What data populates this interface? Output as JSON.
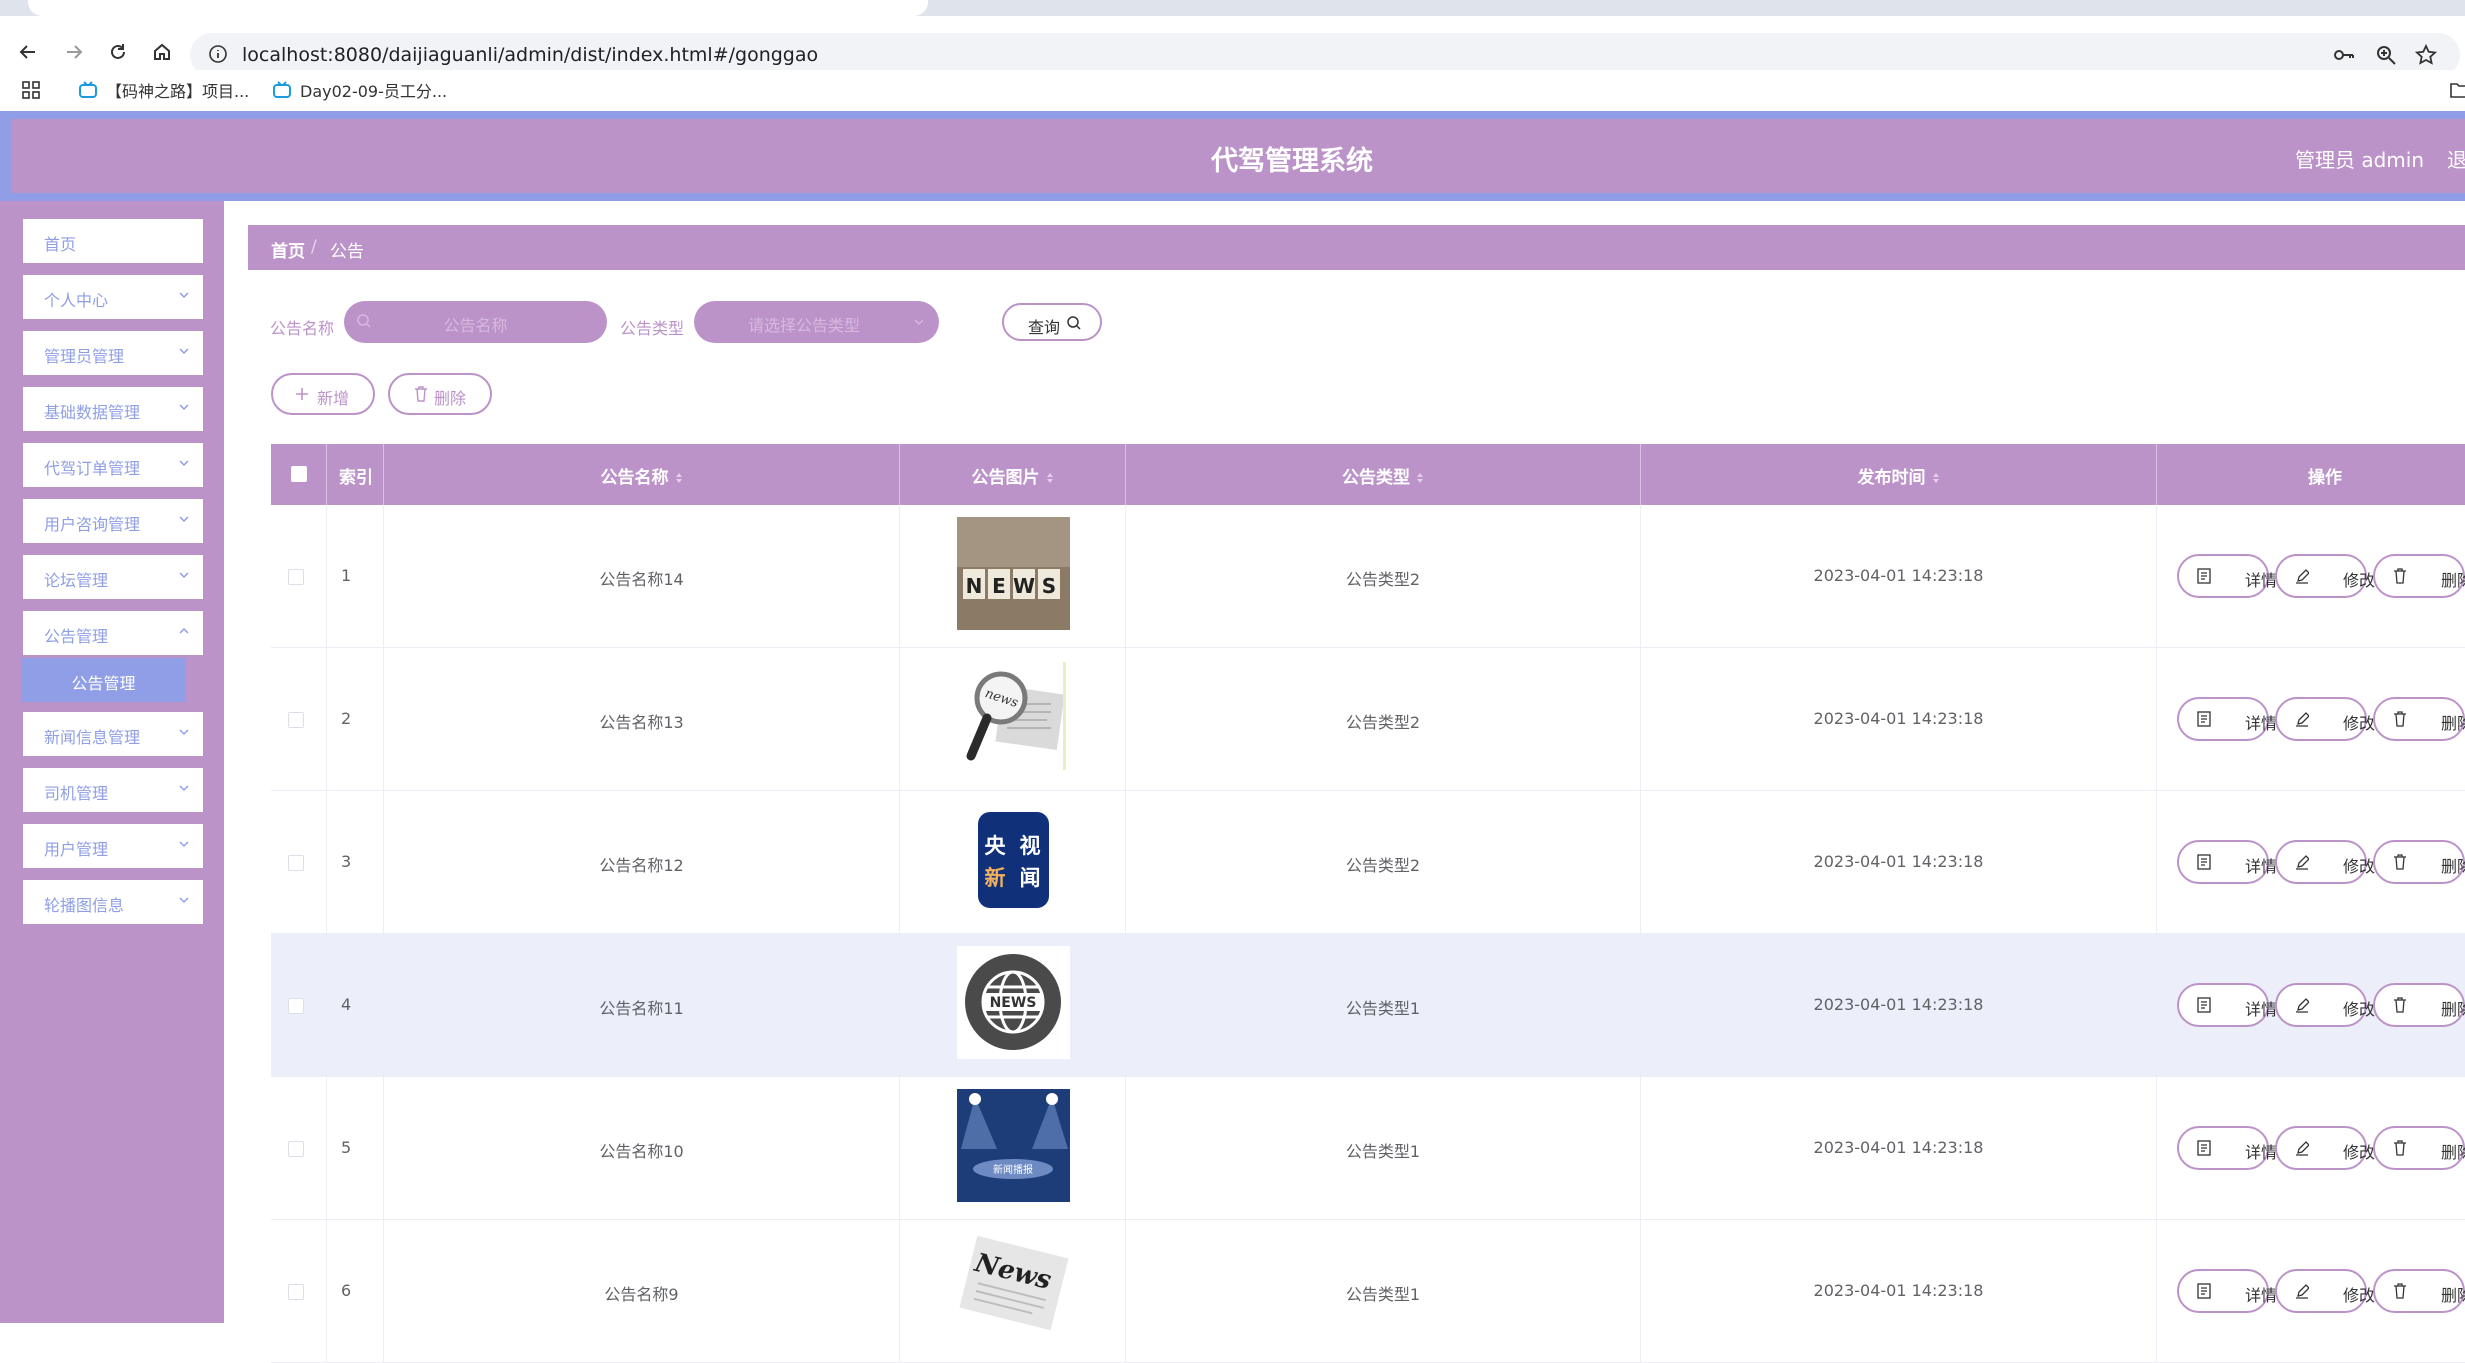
{
  "browser": {
    "url": "localhost:8080/daijiaguanli/admin/dist/index.html#/gonggao",
    "bookmarks": [
      {
        "label": "【码神之路】项目..."
      },
      {
        "label": "Day02-09-员工分..."
      }
    ]
  },
  "header": {
    "title": "代驾管理系统",
    "user": "管理员 admin",
    "logout": "退出登录"
  },
  "sidebar": {
    "items": [
      {
        "label": "首页"
      },
      {
        "label": "个人中心"
      },
      {
        "label": "管理员管理"
      },
      {
        "label": "基础数据管理"
      },
      {
        "label": "代驾订单管理"
      },
      {
        "label": "用户咨询管理"
      },
      {
        "label": "论坛管理"
      },
      {
        "label": "公告管理"
      },
      {
        "label": "新闻信息管理"
      },
      {
        "label": "司机管理"
      },
      {
        "label": "用户管理"
      },
      {
        "label": "轮播图信息"
      }
    ],
    "active_sub": "公告管理"
  },
  "breadcrumb": {
    "home": "首页",
    "sep": "/",
    "current": "公告"
  },
  "search": {
    "name_label": "公告名称",
    "name_placeholder": "公告名称",
    "type_label": "公告类型",
    "type_placeholder": "请选择公告类型",
    "query_button": "查询"
  },
  "actions": {
    "add": "新增",
    "delete": "删除"
  },
  "table": {
    "columns": {
      "index": "索引",
      "name": "公告名称",
      "image": "公告图片",
      "type": "公告类型",
      "time": "发布时间",
      "ops": "操作"
    },
    "op_labels": {
      "detail": "详情",
      "edit": "修改",
      "delete": "删除"
    },
    "rows": [
      {
        "index": "1",
        "name": "公告名称14",
        "image": "news-blocks",
        "type": "公告类型2",
        "time": "2023-04-01 14:23:18",
        "thumb_text": "NEWS"
      },
      {
        "index": "2",
        "name": "公告名称13",
        "image": "magnifier-news",
        "type": "公告类型2",
        "time": "2023-04-01 14:23:18",
        "thumb_text": "news"
      },
      {
        "index": "3",
        "name": "公告名称12",
        "image": "cctv-news",
        "type": "公告类型2",
        "time": "2023-04-01 14:23:18",
        "thumb_text": "央视新闻"
      },
      {
        "index": "4",
        "name": "公告名称11",
        "image": "globe-news",
        "type": "公告类型1",
        "time": "2023-04-01 14:23:18",
        "thumb_text": "NEWS"
      },
      {
        "index": "5",
        "name": "公告名称10",
        "image": "stage-news",
        "type": "公告类型1",
        "time": "2023-04-01 14:23:18",
        "thumb_text": "新闻播报"
      },
      {
        "index": "6",
        "name": "公告名称9",
        "image": "newspaper",
        "type": "公告类型1",
        "time": "2023-04-01 14:23:18",
        "thumb_text": "News"
      }
    ]
  },
  "colors": {
    "primary": "#bc93c9",
    "accent": "#8f9ee6"
  }
}
